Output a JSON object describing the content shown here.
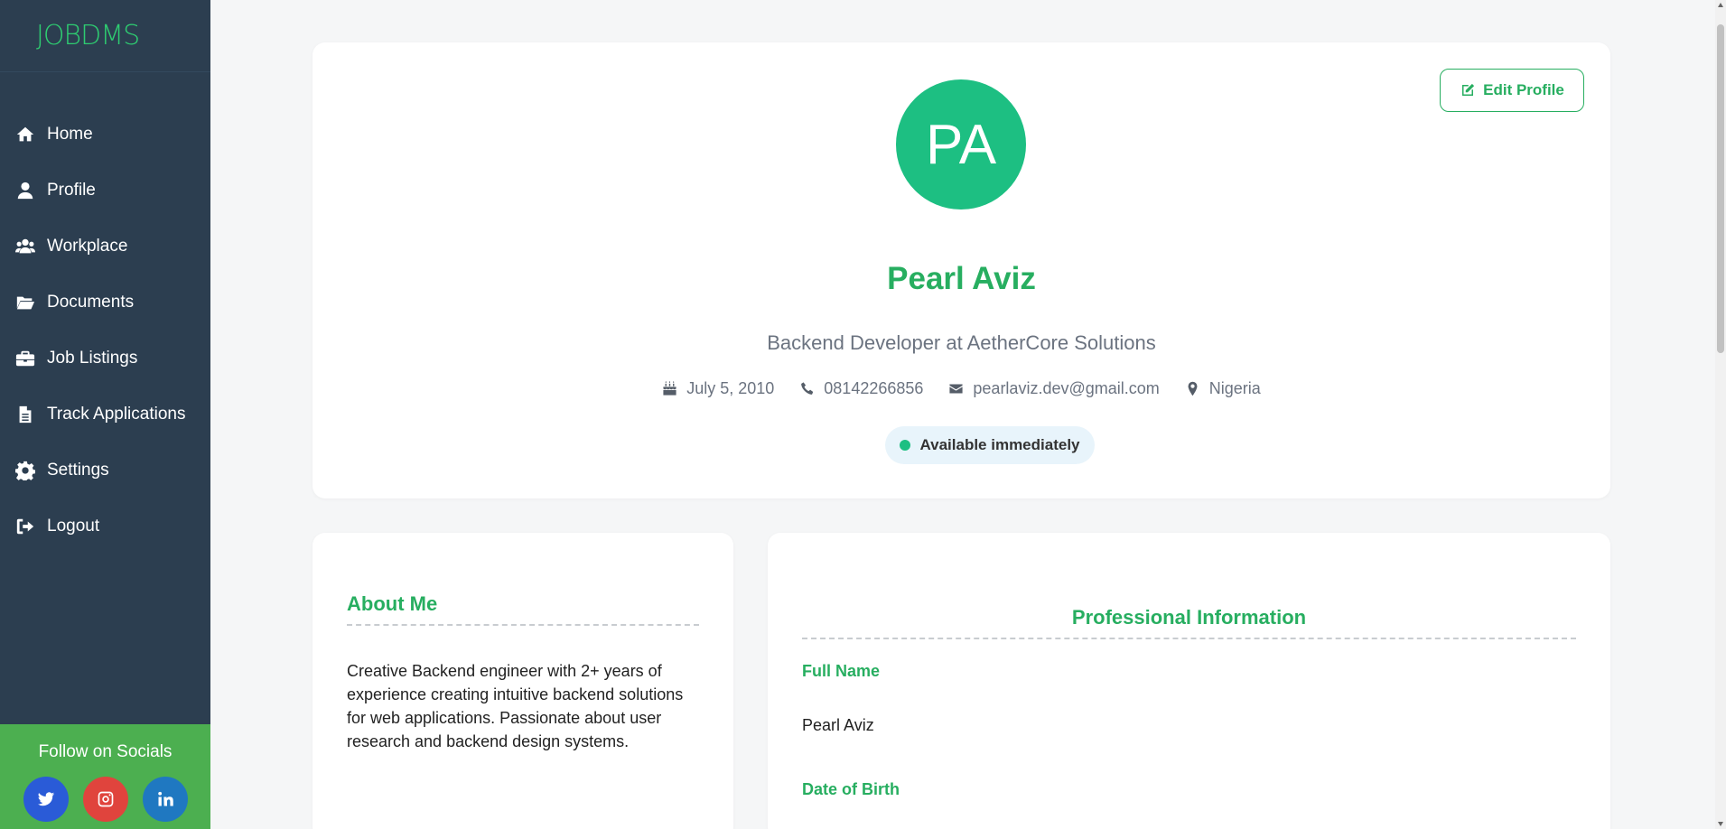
{
  "brand": {
    "logo": "JOBDMS",
    "accent": "#2ecc71",
    "sidebar_bg": "#2c3e50"
  },
  "sidebar": {
    "items": [
      {
        "label": "Home",
        "icon": "home-icon"
      },
      {
        "label": "Profile",
        "icon": "user-icon"
      },
      {
        "label": "Workplace",
        "icon": "users-icon"
      },
      {
        "label": "Documents",
        "icon": "folder-open-icon"
      },
      {
        "label": "Job Listings",
        "icon": "briefcase-icon"
      },
      {
        "label": "Track Applications",
        "icon": "file-icon"
      },
      {
        "label": "Settings",
        "icon": "gear-icon"
      },
      {
        "label": "Logout",
        "icon": "sign-out-icon"
      }
    ],
    "socials": {
      "title": "Follow on Socials",
      "links": [
        {
          "name": "twitter",
          "icon": "twitter-icon",
          "color": "#2a5bd7"
        },
        {
          "name": "instagram",
          "icon": "instagram-icon",
          "color": "#e0443d"
        },
        {
          "name": "linkedin",
          "icon": "linkedin-icon",
          "color": "#1f78c1"
        }
      ]
    }
  },
  "profile": {
    "edit_label": "Edit Profile",
    "initials": "PA",
    "name": "Pearl Aviz",
    "title": "Backend Developer at AetherCore Solutions",
    "dob": "July 5, 2010",
    "phone": "08142266856",
    "email": "pearlaviz.dev@gmail.com",
    "location": "Nigeria",
    "availability": "Available immediately"
  },
  "about": {
    "title": "About Me",
    "text": "Creative Backend engineer with 2+ years of experience creating intuitive backend solutions for web applications. Passionate about user research and backend design systems."
  },
  "professional": {
    "title": "Professional Information",
    "fields": [
      {
        "label": "Full Name",
        "value": "Pearl Aviz"
      },
      {
        "label": "Date of Birth",
        "value": ""
      }
    ]
  }
}
